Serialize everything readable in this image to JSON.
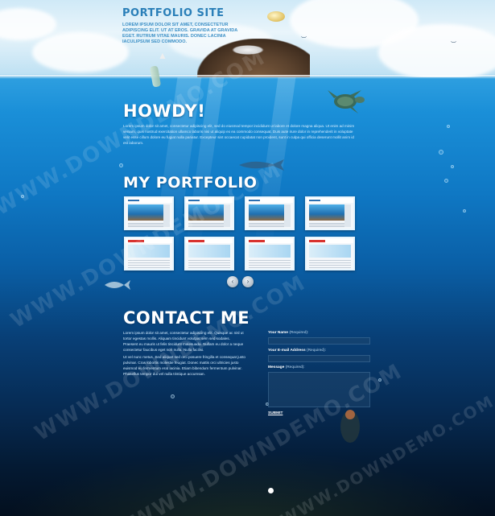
{
  "header": {
    "logo": "PORTFOLIO SITE",
    "tagline": "LOREM IPSUM DOLOR SIT AMET, CONSECTETUR ADIPISCING ELIT. UT AT EROS. GRAVIDA AT GRAVIDA EGET. RUTRUM VITAE MAURIS. DONEC LACINIA IACULIPSUM SED COMMODO."
  },
  "howdy": {
    "title": "HOWDY!",
    "body": "Lorem ipsum dolor sit amet, consectetur adipiscing elit, sed do eiusmod tempor incididunt ut labore et dolore magna aliqua. Ut enim ad minim veniam, quis nostrud exercitation ullamco laboris nisi ut aliquip ex ea commodo consequat. Duis aute irure dolor in reprehenderit in voluptate velit esse cillum dolore eu fugiat nulla pariatur. Excepteur sint occaecat cupidatat non proident, sunt in culpa qui officia deserunt mollit anim id est laborum."
  },
  "portfolio": {
    "title": "MY PORTFOLIO",
    "prev_icon": "‹",
    "next_icon": "›"
  },
  "contact": {
    "title": "CONTACT ME",
    "para1": "Lorem ipsum dolor sit amet, consectetur adipiscing elit. Quisque ac nisl ut tortor egestas mollis. Aliquam tincidunt volutpat sem sed sodales. Praesent eu mauris ut felis tincidunt malesuada. Nullam eu dolor a neque consectetur faucibus eget non nulla. Nulla facilisi.",
    "para2": "Ut vel nunc metus. Sed aliquet sed orci posuere fringilla et consequat justo pulvinar. Cras lobortis molestie feugiat. Donec mattis orci ultricies justo euismod eu fermentum erat lacinia. Etiam bibendum fermentum pulvinar. Phasellus tempor dui vel nulla tristique accumsan.",
    "name_label": "Your Name",
    "name_req": "(Required):",
    "email_label": "Your E-mail Address",
    "email_req": "(Required):",
    "message_label": "Message",
    "message_req": "(Required):",
    "submit": "SUBMIT"
  },
  "watermark": "WWW.DOWNDEMO.COM",
  "colors": {
    "accent": "#2a7fb8",
    "water_top": "#2e9fe0",
    "water_deep": "#030f1e",
    "red_accent": "#d8332f"
  }
}
